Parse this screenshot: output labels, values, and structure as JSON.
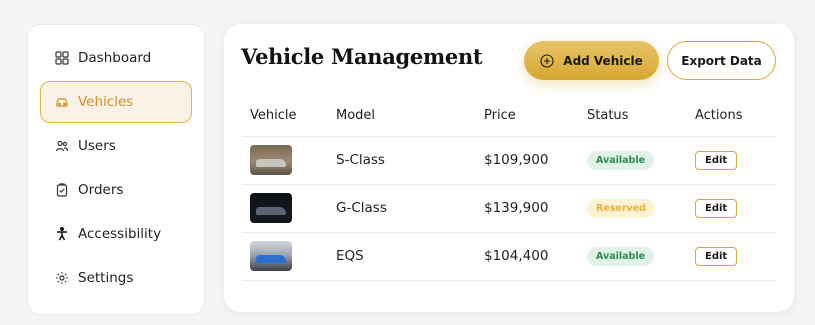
{
  "colors": {
    "accent": "#d6a830",
    "available_bg": "#e1f3e6",
    "available_fg": "#2e8a4b",
    "reserved_bg": "#fdf3d2",
    "reserved_fg": "#e6b33a"
  },
  "sidebar": {
    "items": [
      {
        "label": "Dashboard",
        "icon": "grid-icon"
      },
      {
        "label": "Vehicles",
        "icon": "car-icon",
        "active": true
      },
      {
        "label": "Users",
        "icon": "users-icon"
      },
      {
        "label": "Orders",
        "icon": "clipboard-check-icon"
      },
      {
        "label": "Accessibility",
        "icon": "accessibility-icon"
      },
      {
        "label": "Settings",
        "icon": "gear-icon"
      }
    ]
  },
  "main": {
    "title": "Vehicle Management",
    "add_button": "Add Vehicle",
    "export_button": "Export Data",
    "table": {
      "headers": [
        "Vehicle",
        "Model",
        "Price",
        "Status",
        "Actions"
      ],
      "rows": [
        {
          "model": "S-Class",
          "price": "$109,900",
          "status": "Available",
          "action": "Edit"
        },
        {
          "model": "G-Class",
          "price": "$139,900",
          "status": "Reserved",
          "action": "Edit"
        },
        {
          "model": "EQS",
          "price": "$104,400",
          "status": "Available",
          "action": "Edit"
        }
      ]
    }
  }
}
